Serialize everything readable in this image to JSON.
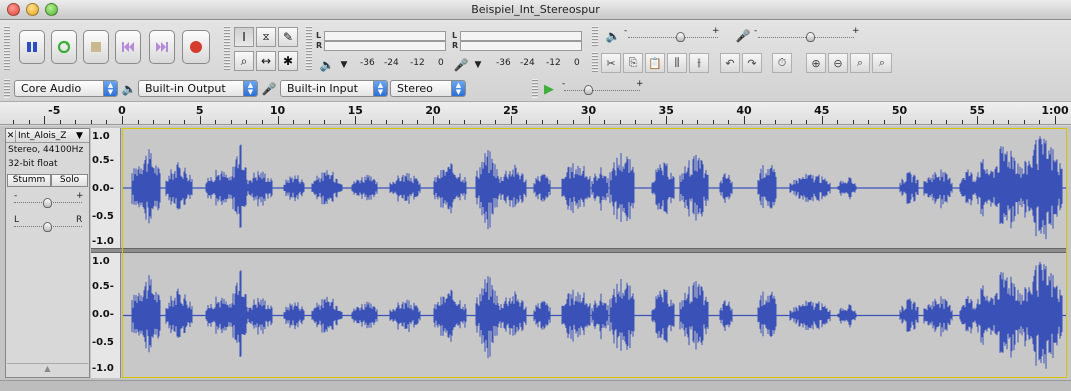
{
  "window": {
    "title": "Beispiel_Int_Stereospur"
  },
  "meters": {
    "playback_scale": [
      "-36",
      "-24",
      "-12",
      "0"
    ],
    "record_scale": [
      "-36",
      "-24",
      "-12",
      "0"
    ],
    "left": "L",
    "right": "R"
  },
  "mixer": {
    "minus": "-",
    "plus": "+"
  },
  "device_bar": {
    "host": "Core Audio",
    "output": "Built-in Output",
    "input": "Built-in Input",
    "channels": "Stereo"
  },
  "ruler": {
    "labels": [
      "-5",
      "0",
      "5",
      "10",
      "15",
      "20",
      "25",
      "30",
      "35",
      "40",
      "45",
      "50",
      "55",
      "1:00"
    ]
  },
  "track": {
    "name": "Int_Alois_Z",
    "info_rate": "Stereo, 44100Hz",
    "info_format": "32-bit float",
    "mute_label": "Stumm",
    "solo_label": "Solo",
    "gain_minus": "-",
    "gain_plus": "+",
    "pan_left": "L",
    "pan_right": "R",
    "y_labels": [
      "1.0",
      "0.5-",
      "0.0-",
      "-0.5",
      "-1.0"
    ]
  },
  "colors": {
    "waveform": "#3a52b8",
    "waveform_light": "#6f82d6",
    "selection_border": "#d7c400",
    "record_red": "#d63b2f",
    "play_green": "#3fae3a"
  }
}
